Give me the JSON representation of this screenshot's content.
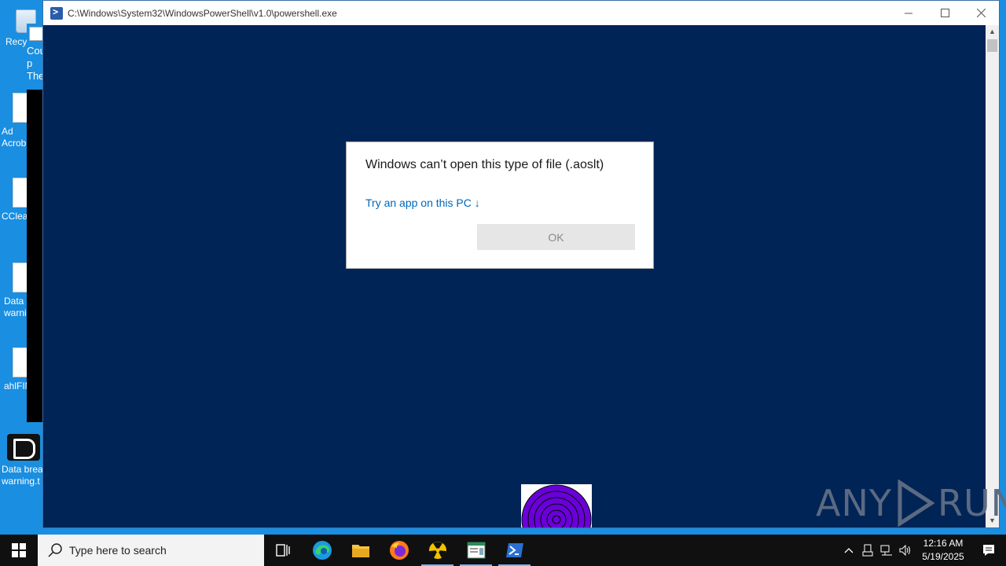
{
  "desktop": {
    "icons": [
      {
        "label": "Recy",
        "name": "recycle-bin"
      },
      {
        "label": "Ad\nAcrob",
        "name": "adobe-acrobat"
      },
      {
        "label": "CClea",
        "name": "ccleaner"
      },
      {
        "label": "Data b\nwarni",
        "name": "data-warning-file"
      },
      {
        "label": "ahlFIN",
        "name": "ahlfin-file"
      },
      {
        "label": "Data brea\nwarning.t",
        "name": "data-breach-warning"
      }
    ],
    "bg_window_text": "Cou\np\nThe"
  },
  "window": {
    "title": "C:\\Windows\\System32\\WindowsPowerShell\\v1.0\\powershell.exe",
    "minimize": "—",
    "maximize": "☐",
    "close": "✕"
  },
  "dialog": {
    "title": "Windows can’t open this type of file (.aoslt)",
    "link": "Try an app on this PC ↓",
    "ok_label": "OK"
  },
  "watermark": {
    "left": "ANY",
    "right": "RUN"
  },
  "taskbar": {
    "search_placeholder": "Type here to search",
    "time": "12:16 AM",
    "date": "5/19/2025"
  },
  "colors": {
    "powershell_bg": "#012456",
    "desktop_bg": "#1a8ee0",
    "link": "#0067b8",
    "taskbar": "#101010"
  }
}
